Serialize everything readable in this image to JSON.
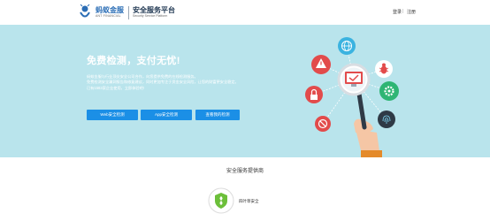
{
  "header": {
    "brand_cn": "蚂蚁金服",
    "brand_en": "ANT FINANCIAL",
    "platform_cn": "安全服务平台",
    "platform_en": "Security Service Platform",
    "login": "登录",
    "separator": "|",
    "register": "注册"
  },
  "hero": {
    "title": "免费检测，支付无忧!",
    "desc": [
      "蚂蚁金服与行业顶尖安全公司合作，向您提供免费的在线检测服务。",
      "免费检测安全漏洞报告和修复建议，同时更加专注于资金安全风险，让您的财富更安全稳定。",
      "已有1583家企业使用，立即体验吧!"
    ],
    "buttons": {
      "web": "Web安全检测",
      "app": "App安全检测",
      "history": "查看我的检测"
    }
  },
  "providers": {
    "title": "安全服务提供商",
    "items": [
      {
        "name": "四叶草安全"
      }
    ]
  },
  "colors": {
    "hero_bg": "#b9e4ec",
    "button": "#1b8fe6"
  }
}
